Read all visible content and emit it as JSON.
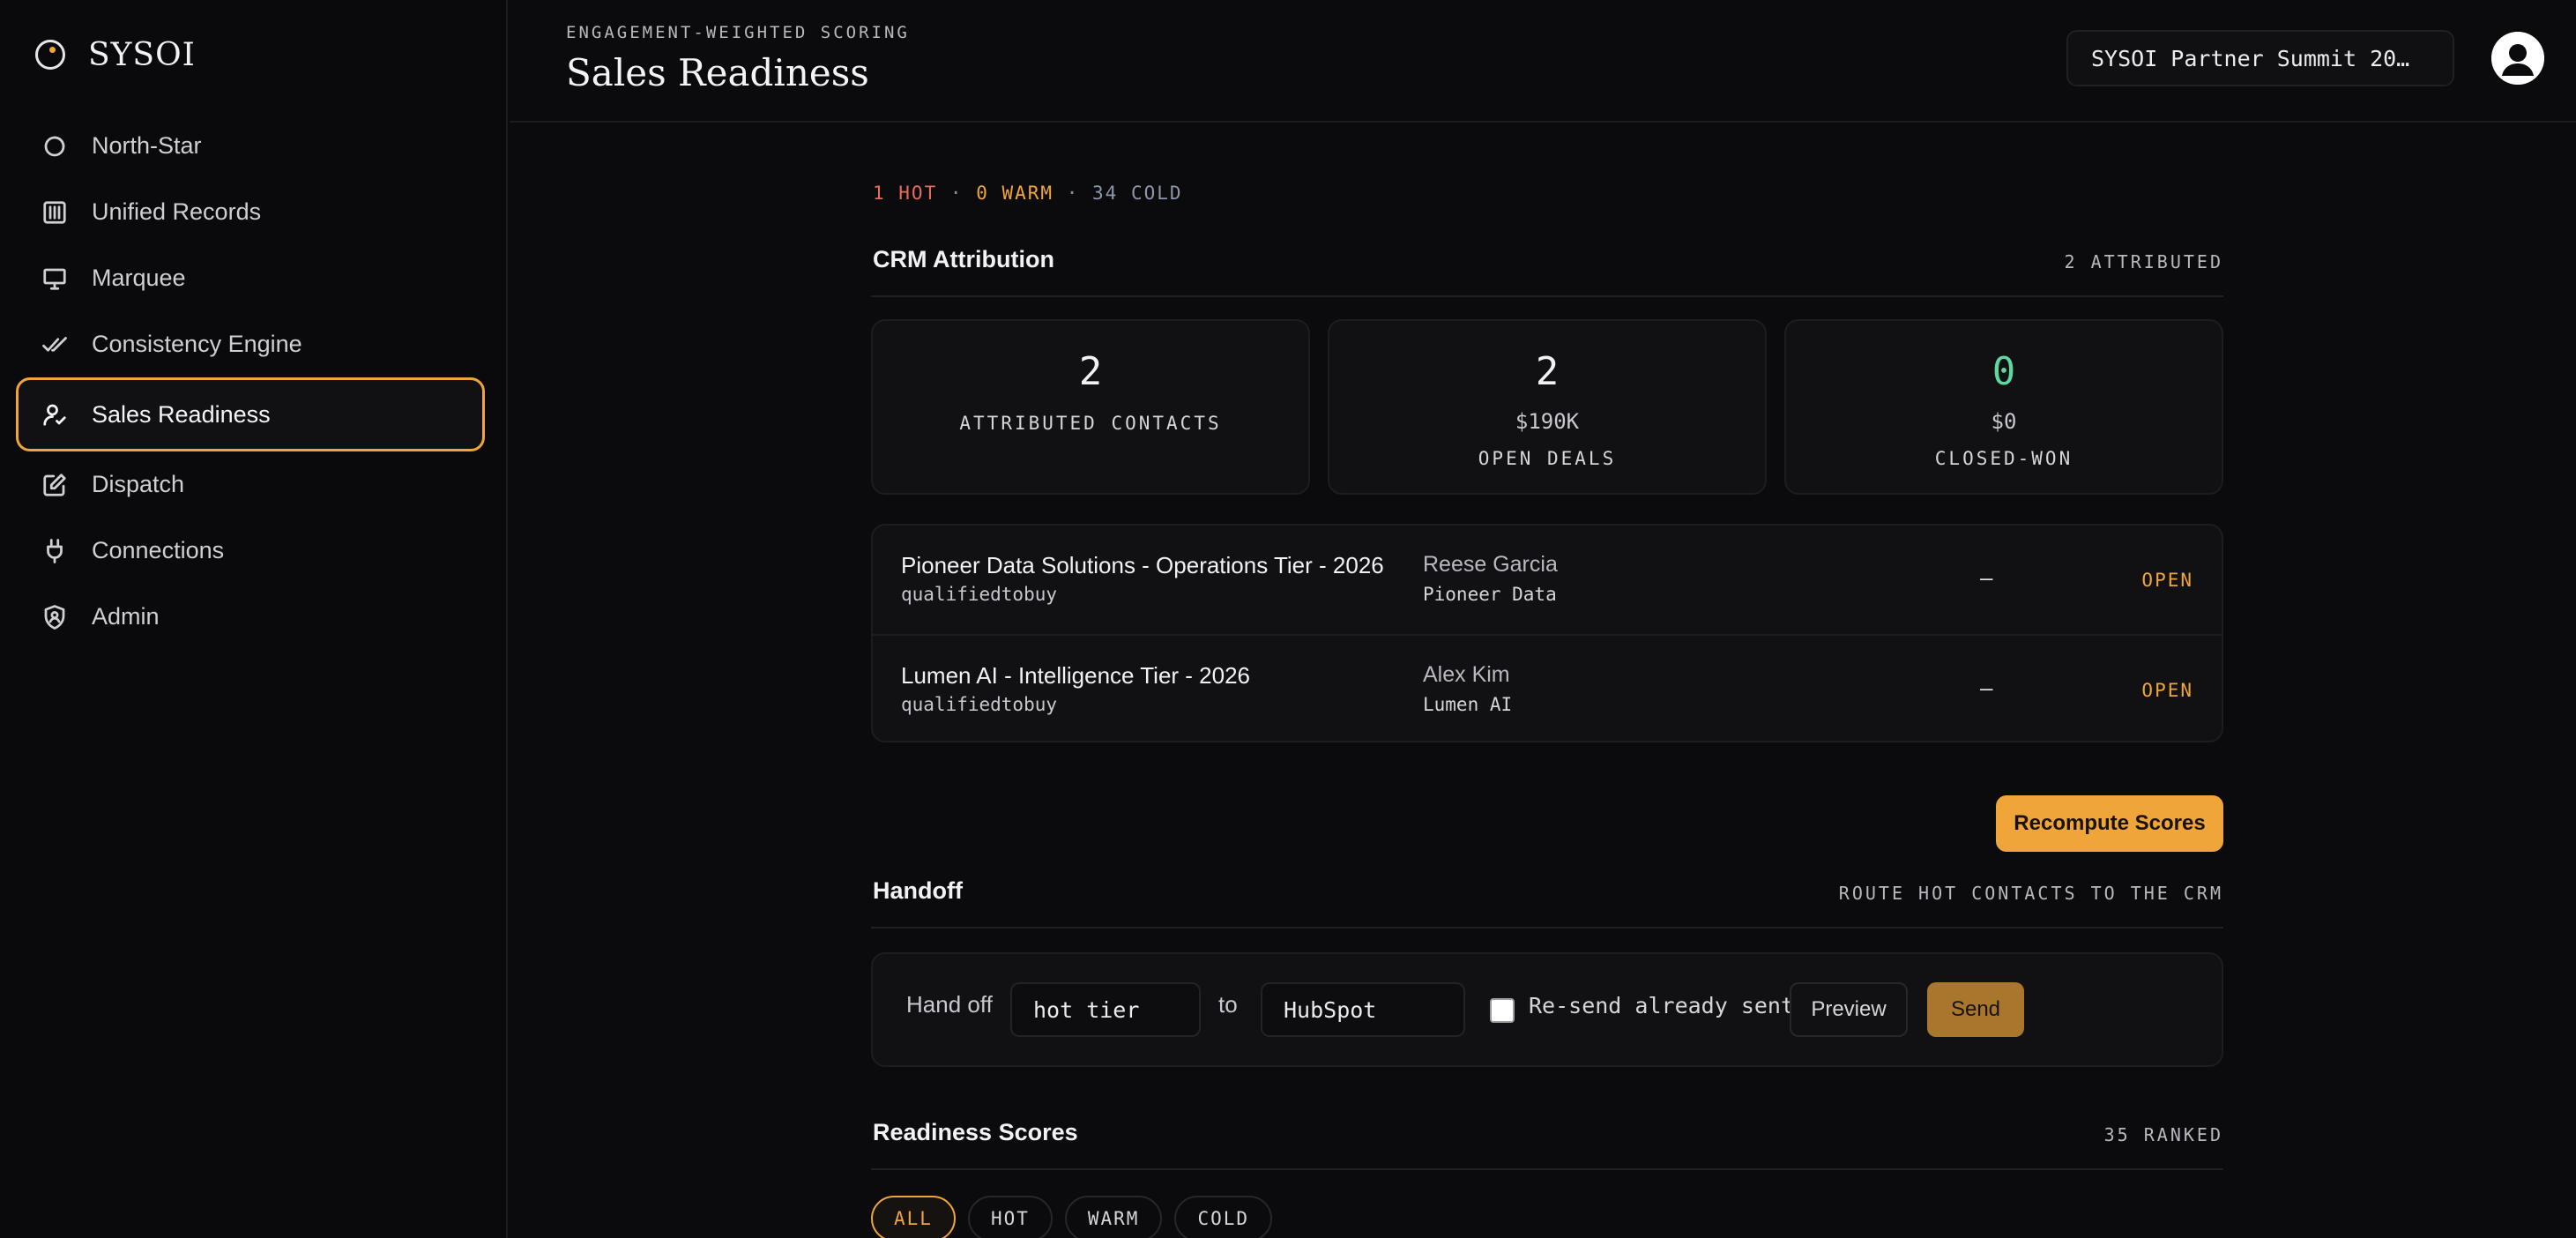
{
  "brand": {
    "name": "SYSOI"
  },
  "nav": {
    "items": [
      {
        "label": "North-Star",
        "icon": "north-star-icon"
      },
      {
        "label": "Unified Records",
        "icon": "records-icon"
      },
      {
        "label": "Marquee",
        "icon": "presentation-icon"
      },
      {
        "label": "Consistency Engine",
        "icon": "double-check-icon"
      },
      {
        "label": "Sales Readiness",
        "icon": "user-check-icon",
        "active": true
      },
      {
        "label": "Dispatch",
        "icon": "edit-icon"
      },
      {
        "label": "Connections",
        "icon": "plug-icon"
      },
      {
        "label": "Admin",
        "icon": "shield-user-icon"
      }
    ]
  },
  "header": {
    "eyebrow": "ENGAGEMENT-WEIGHTED SCORING",
    "title": "Sales Readiness",
    "event_selector": "SYSOI Partner Summit 20…"
  },
  "tiers": {
    "hot": "1 HOT",
    "warm": "0 WARM",
    "cold": "34 COLD",
    "separator": "·"
  },
  "crm": {
    "title": "CRM Attribution",
    "meta": "2 ATTRIBUTED",
    "stats": [
      {
        "number": "2",
        "sub": "",
        "label": "ATTRIBUTED CONTACTS"
      },
      {
        "number": "2",
        "sub": "$190K",
        "label": "OPEN DEALS"
      },
      {
        "number": "0",
        "sub": "$0",
        "label": "CLOSED-WON"
      }
    ],
    "deals": [
      {
        "name": "Pioneer Data Solutions - Operations Tier - 2026",
        "stage": "qualifiedtobuy",
        "contact": "Reese Garcia",
        "company": "Pioneer Data",
        "amount": "—",
        "status": "OPEN"
      },
      {
        "name": "Lumen AI - Intelligence Tier - 2026",
        "stage": "qualifiedtobuy",
        "contact": "Alex Kim",
        "company": "Lumen AI",
        "amount": "—",
        "status": "OPEN"
      }
    ]
  },
  "actions": {
    "recompute_label": "Recompute Scores"
  },
  "handoff": {
    "title": "Handoff",
    "meta": "ROUTE HOT CONTACTS TO THE CRM",
    "label": "Hand off",
    "tier_value": "hot tier",
    "to_label": "to",
    "destination_value": "HubSpot",
    "resend_label": "Re-send already sent",
    "resend_checked": false,
    "preview_label": "Preview",
    "send_label": "Send"
  },
  "readiness": {
    "title": "Readiness Scores",
    "meta": "35 RANKED",
    "filters": [
      {
        "label": "ALL",
        "active": true
      },
      {
        "label": "HOT"
      },
      {
        "label": "WARM"
      },
      {
        "label": "COLD"
      }
    ]
  },
  "colors": {
    "accent": "#f0a53a",
    "hot": "#e86a5c",
    "cold": "#8e96a8",
    "success": "#5fd8a0"
  }
}
